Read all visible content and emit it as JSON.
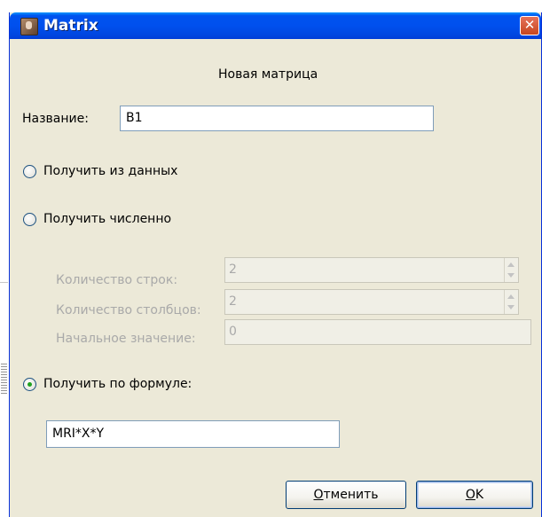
{
  "window": {
    "title": "Matrix",
    "close_glyph": "✕",
    "accent": "#0053ee"
  },
  "dialog": {
    "heading": "Новая матрица",
    "name_label": "Название:",
    "name_value": "B1",
    "option_data": "Получить из данных",
    "option_numeric": "Получить численно",
    "rows_label": "Количество строк:",
    "rows_value": "2",
    "cols_label": "Количество столбцов:",
    "cols_value": "2",
    "init_label": "Начальное значение:",
    "init_value": "0",
    "option_formula": "Получить по формуле:",
    "formula_value": "MRI*X*Y",
    "selected_option": "formula",
    "cancel_label": "Отменить",
    "ok_label": "OK"
  }
}
